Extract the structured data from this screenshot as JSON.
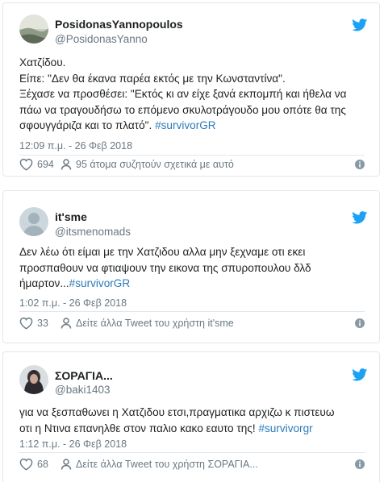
{
  "colors": {
    "link": "#2b7bb9",
    "muted": "#697882",
    "twitter_blue": "#1da1f2",
    "border": "#e1e8ed"
  },
  "tweets": [
    {
      "name": "PosidonasYannopoulos",
      "handle": "@PosidonasYanno",
      "lines": [
        "Χατζίδου.",
        "Είπε: \"Δεν θα έκανα παρέα εκτός με την Κωνσταντίνα\".",
        "Ξέχασε να προσθέσει: \"Εκτός κι αν είχε ξανά εκπομπή και ήθελα να",
        "πάω να τραγουδήσω το επόμενο σκυλοτράγουδο μου οπότε θα της",
        "σφουγγάριζα και το πλατό\". "
      ],
      "hashtag": "#survivorGR",
      "time": "12:09 π.μ. - 26 Φεβ 2018",
      "likes": "694",
      "action_text": "95 άτομα συζητούν σχετικά με αυτό",
      "avatar_icon": "avatar-landscape",
      "action_icon": "person-icon"
    },
    {
      "name": "it'sme",
      "handle": "@itsmenomads",
      "lines": [
        "Δεν λέω ότι είμαι με την Χατζιδου αλλα μην ξεχναμε οτι εκει",
        "προσπαθουν να φτιαψουν την εικονα της σπυροπουλου δλδ",
        "ήμαρτον..."
      ],
      "hashtag": "#survivorGR",
      "time": "1:02 π.μ. - 26 Φεβ 2018",
      "likes": "33",
      "action_text": "Δείτε άλλα Tweet του χρήστη it'sme",
      "avatar_icon": "avatar-default",
      "action_icon": "person-icon"
    },
    {
      "name": "ΣΟΡΑΓΙΑ...",
      "handle": "@baki1403",
      "lines": [
        "για να ξεσπαθωνει η Χατζιδου ετσι,πραγματικα αρχιζω κ πιστευω",
        "οτι η Ντινα επανηλθε στον παλιο κακο εαυτο της!  "
      ],
      "hashtag": "#survivorgr",
      "time": "1:12 π.μ. - 26 Φεβ 2018",
      "likes": "68",
      "action_text": "Δείτε άλλα Tweet του χρήστη ΣΟΡΑΓΙΑ...",
      "avatar_icon": "avatar-photo",
      "action_icon": "person-icon"
    }
  ]
}
